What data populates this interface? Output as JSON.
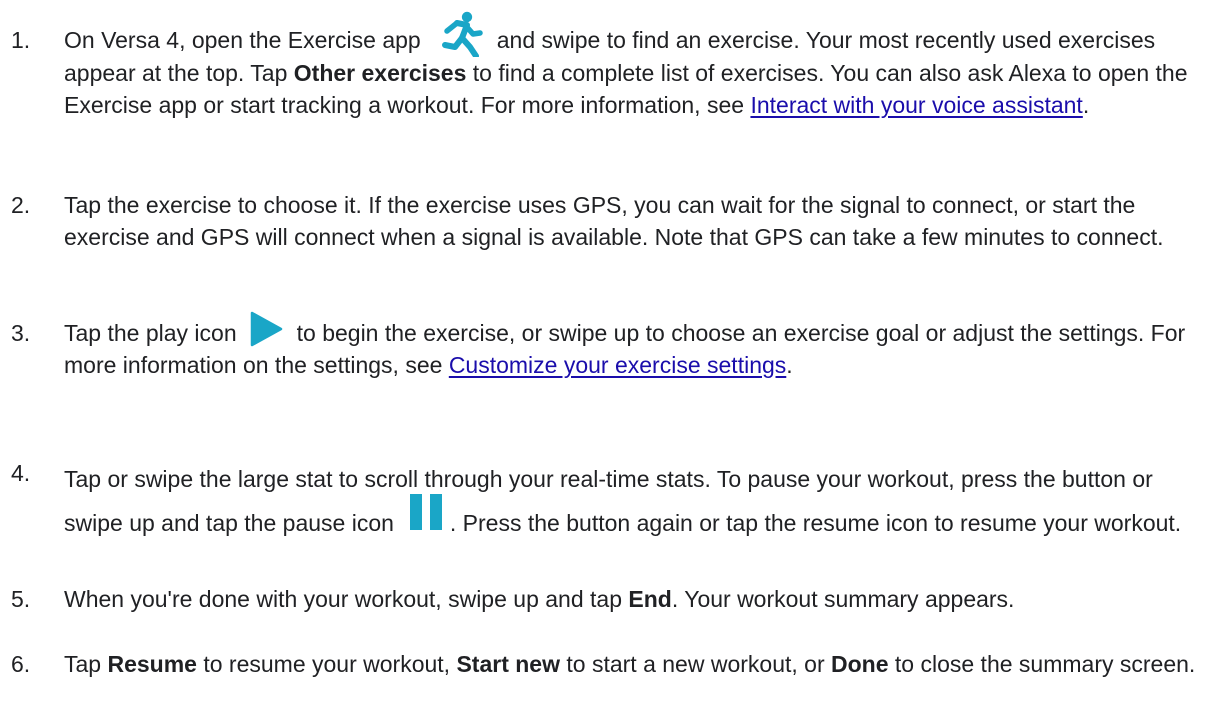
{
  "colors": {
    "text": "#202124",
    "link": "#1a0dab",
    "icon_accent": "#1aa6c7"
  },
  "steps": [
    {
      "number": "1.",
      "p1": "On Versa 4, open the Exercise app",
      "icon": "running-person-icon",
      "p2": "and swipe to find an exercise. Your most recently used exercises appear at the top. Tap ",
      "b1": "Other exercises",
      "p3": " to find a complete list of exercises. You can also ask Alexa to open the Exercise app or start tracking a workout. For more information, see ",
      "link": "Interact with your voice assistant",
      "p4": "."
    },
    {
      "number": "2.",
      "p1": "Tap the exercise to choose it. If the exercise uses GPS, you can wait for the signal to connect, or start the exercise and GPS will connect when a signal is available. Note that GPS can take a few minutes to connect."
    },
    {
      "number": "3.",
      "p1": "Tap the play icon",
      "icon": "play-icon",
      "p2": "to begin the exercise, or swipe up to choose an exercise goal or adjust the settings. For more information on the settings, see ",
      "link": "Customize your exercise settings",
      "p3": "."
    },
    {
      "number": "4.",
      "p1": "Tap or swipe the large stat to scroll through your real-time stats. To pause your workout, press the button or swipe up and tap the pause icon",
      "icon": "pause-icon",
      "p2": ". Press the button again or tap the resume icon to resume your workout."
    },
    {
      "number": "5.",
      "p1": "When you're done with your workout, swipe up and tap ",
      "b1": "End",
      "p2": ". Your workout summary appears."
    },
    {
      "number": "6.",
      "p1": "Tap ",
      "b1": "Resume",
      "p2": " to resume your workout, ",
      "b2": "Start new",
      "p3": " to start a new workout, or ",
      "b3": "Done",
      "p4": " to close the summary screen."
    }
  ]
}
